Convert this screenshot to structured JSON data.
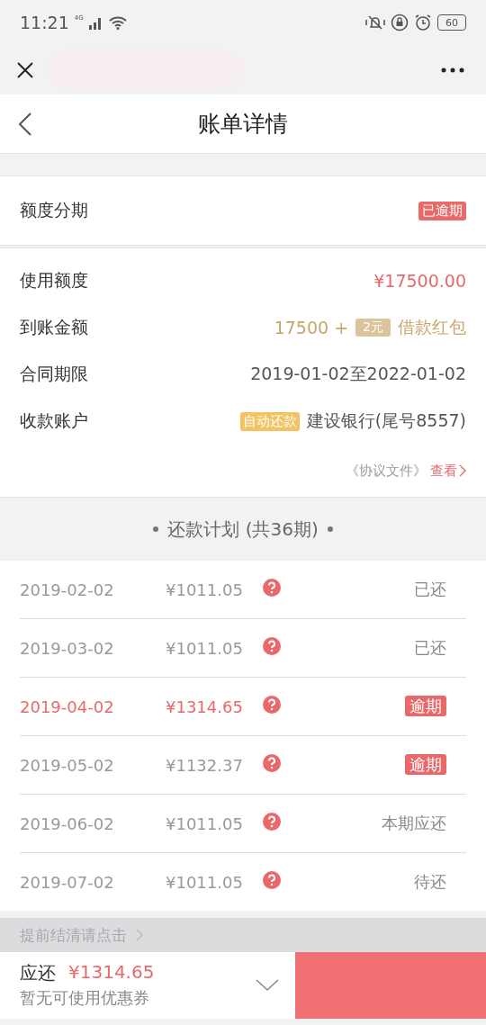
{
  "status_bar": {
    "time": "11:21",
    "network": "4G",
    "battery": "60"
  },
  "title": "账单详情",
  "product": {
    "name": "额度分期",
    "badge": "已逾期"
  },
  "details": [
    {
      "kind": "amount",
      "label": "使用额度",
      "value": "¥17500.00"
    },
    {
      "kind": "bonus",
      "label": "到账金额",
      "value": "17500 +",
      "tag": "2元",
      "suffix": "借款红包"
    },
    {
      "kind": "plain",
      "label": "合同期限",
      "value": "2019-01-02至2022-01-02"
    },
    {
      "kind": "account",
      "label": "收款账户",
      "tag": "自动还款",
      "value": "建设银行(尾号8557)"
    }
  ],
  "agreement": {
    "text": "《协议文件》",
    "link": "查看"
  },
  "plan": {
    "title": "还款计划 (共36期)",
    "rows": [
      {
        "kind": "text",
        "date": "2019-02-02",
        "amount": "¥1011.05",
        "status": "已还",
        "highlighted": false
      },
      {
        "kind": "text",
        "date": "2019-03-02",
        "amount": "¥1011.05",
        "status": "已还",
        "highlighted": false
      },
      {
        "kind": "badge",
        "date": "2019-04-02",
        "amount": "¥1314.65",
        "status": "逾期",
        "highlighted": true
      },
      {
        "kind": "badge",
        "date": "2019-05-02",
        "amount": "¥1132.37",
        "status": "逾期",
        "highlighted": false
      },
      {
        "kind": "text",
        "date": "2019-06-02",
        "amount": "¥1011.05",
        "status": "本期应还",
        "highlighted": false
      },
      {
        "kind": "text",
        "date": "2019-07-02",
        "amount": "¥1011.05",
        "status": "待还",
        "highlighted": false
      }
    ]
  },
  "early_payoff": "提前结清请点击",
  "footer": {
    "label": "应还",
    "amount": "¥1314.65",
    "coupon": "暂无可使用优惠券"
  }
}
